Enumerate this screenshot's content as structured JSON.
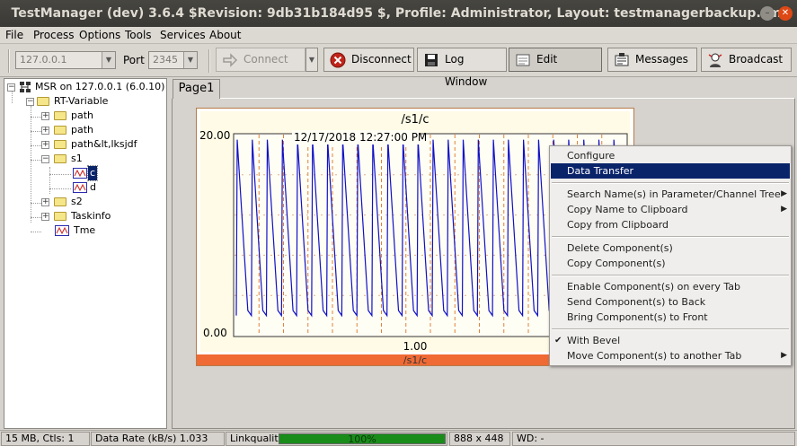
{
  "window": {
    "title": "TestManager (dev) 3.6.4 $Revision: 9db31b184d95 $, Profile: Administrator, Layout: testmanagerbackup.sml"
  },
  "menu": {
    "file": "File",
    "process": "Process",
    "options": "Options",
    "tools": "Tools",
    "services": "Services",
    "about": "About"
  },
  "toolbar": {
    "host": "127.0.0.1",
    "port_label": "Port",
    "port": "2345",
    "connect": "Connect",
    "disconnect": "Disconnect",
    "log_window": "Log Window",
    "edit": "Edit",
    "messages": "Messages",
    "broadcast": "Broadcast"
  },
  "tree": {
    "root": "MSR on 127.0.0.1 (6.0.10)",
    "rt": "RT-Variable",
    "path1": "path",
    "path2": "path",
    "path3": "path&lt,lksjdf",
    "s1": "s1",
    "c": "c",
    "d": "d",
    "s2": "s2",
    "taskinfo": "Taskinfo",
    "tme": "Tme"
  },
  "tabs": {
    "page1": "Page1"
  },
  "chart_data": {
    "type": "line",
    "title": "/s1/c",
    "timestamp": "12/17/2018 12:27:00 PM",
    "ytick_top": "20.00",
    "ytick_bottom": "0.00",
    "xtick": "1.00",
    "footer": "/s1/c",
    "ylim": [
      0,
      20
    ],
    "series": [
      {
        "color": "#1010c8",
        "cycles": 26,
        "low": 2,
        "high": 19.5
      }
    ]
  },
  "context_menu": {
    "configure": "Configure",
    "data_transfer": "Data Transfer",
    "search_names": "Search Name(s) in Parameter/Channel Tree",
    "copy_name": "Copy Name to Clipboard",
    "copy_from": "Copy from Clipboard",
    "delete": "Delete Component(s)",
    "copy_component": "Copy Component(s)",
    "enable_every_tab": "Enable Component(s) on every Tab",
    "send_back": "Send Component(s) to Back",
    "bring_front": "Bring Component(s) to Front",
    "with_bevel": "With Bevel",
    "move_to_tab": "Move Component(s) to another Tab"
  },
  "status": {
    "memory": "15 MB, Ctls: 1",
    "data_rate": "Data Rate (kB/s) 1.033",
    "link_label": "Linkqualit",
    "link_value": "100%",
    "link_quality": 1.0,
    "size": "888 x 448",
    "wd": "WD: -"
  }
}
